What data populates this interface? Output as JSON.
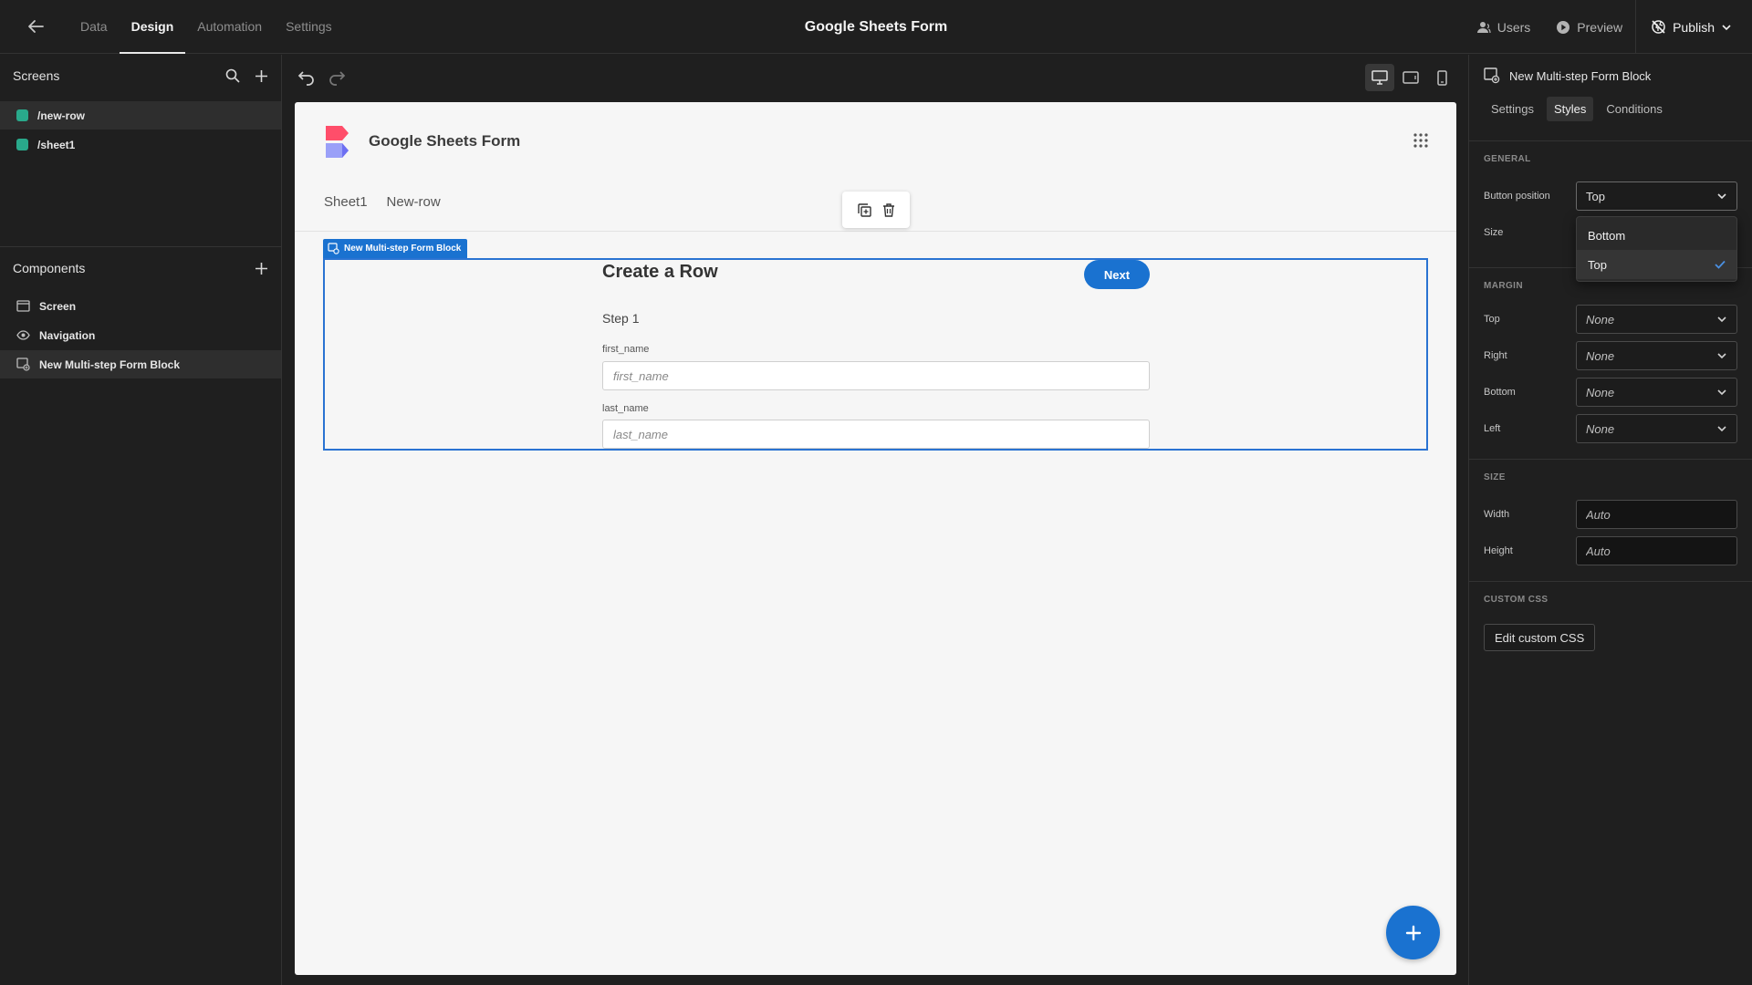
{
  "topbar": {
    "nav": [
      "Data",
      "Design",
      "Automation",
      "Settings"
    ],
    "active_nav": "Design",
    "app_title": "Google Sheets Form",
    "users": "Users",
    "preview": "Preview",
    "publish": "Publish"
  },
  "screens_panel": {
    "title": "Screens",
    "items": [
      {
        "label": "/new-row",
        "color": "#29a98b",
        "selected": true
      },
      {
        "label": "/sheet1",
        "color": "#29a98b",
        "selected": false
      }
    ]
  },
  "components_panel": {
    "title": "Components",
    "items": [
      {
        "label": "Screen",
        "icon": "screen-icon"
      },
      {
        "label": "Navigation",
        "icon": "eye-icon"
      },
      {
        "label": "New Multi-step Form Block",
        "icon": "form-block-icon",
        "selected": true
      }
    ]
  },
  "preview_app": {
    "name": "Google Sheets Form",
    "links": [
      "Sheet1",
      "New-row"
    ],
    "block_label": "New Multi-step Form Block",
    "form": {
      "title": "Create a Row",
      "next_label": "Next",
      "step": "Step 1",
      "fields": [
        {
          "label": "first_name",
          "placeholder": "first_name"
        },
        {
          "label": "last_name",
          "placeholder": "last_name"
        }
      ]
    }
  },
  "settings_panel": {
    "component_name": "New Multi-step Form Block",
    "tabs": [
      "Settings",
      "Styles",
      "Conditions"
    ],
    "active_tab": "Styles",
    "general": {
      "title": "GENERAL",
      "button_position_label": "Button position",
      "button_position_value": "Top",
      "size_label": "Size"
    },
    "dropdown": {
      "options": [
        "Bottom",
        "Top"
      ],
      "selected": "Top"
    },
    "margin": {
      "title": "MARGIN",
      "top_label": "Top",
      "top_value": "None",
      "right_label": "Right",
      "right_value": "None",
      "bottom_label": "Bottom",
      "bottom_value": "None",
      "left_label": "Left",
      "left_value": "None"
    },
    "size": {
      "title": "SIZE",
      "width_label": "Width",
      "width_placeholder": "Auto",
      "height_label": "Height",
      "height_placeholder": "Auto"
    },
    "custom_css": {
      "title": "CUSTOM CSS",
      "button": "Edit custom CSS"
    }
  },
  "colors": {
    "accent": "#1a72d0",
    "screen_dot": "#29a98b"
  }
}
